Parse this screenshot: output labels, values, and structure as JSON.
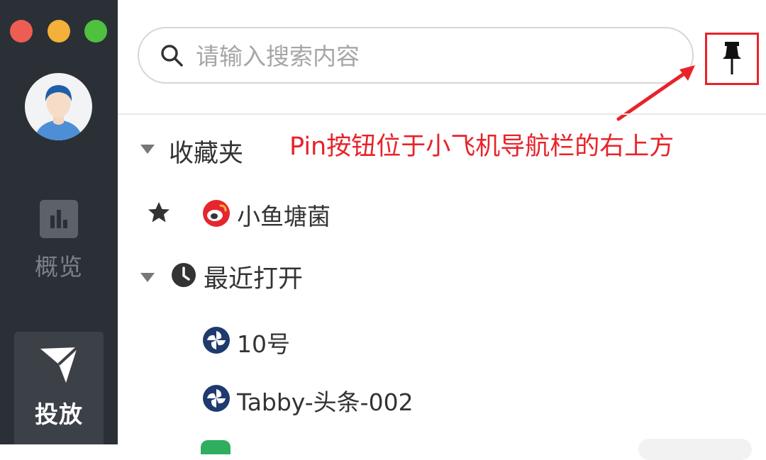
{
  "window": {
    "controls": [
      "close",
      "minimize",
      "maximize"
    ]
  },
  "sidebar": {
    "avatar_icon": "user-avatar",
    "items": [
      {
        "label": "概览",
        "icon": "bar-chart-icon",
        "active": false
      },
      {
        "label": "投放",
        "icon": "paper-plane-icon",
        "active": true
      }
    ]
  },
  "search": {
    "placeholder": "请输入搜索内容",
    "icon": "search-icon"
  },
  "pin_button": {
    "icon": "pushpin-icon"
  },
  "annotation": {
    "text": "Pin按钮位于小飞机导航栏的右上方",
    "color": "#e8232a"
  },
  "favorites": {
    "label": "收藏夹",
    "items": [
      {
        "label": "小鱼塘菌",
        "icon": "weibo-icon",
        "starred": true
      }
    ]
  },
  "recent": {
    "label": "最近打开",
    "items": [
      {
        "label": "10号",
        "icon": "pinwheel-icon"
      },
      {
        "label": "Tabby-头条-002",
        "icon": "pinwheel-icon"
      }
    ]
  },
  "colors": {
    "sidebar_bg": "#2b3036",
    "active_nav_bg": "#3c4148",
    "accent_red": "#e8232a",
    "account_icon": "#1e3a6e"
  }
}
